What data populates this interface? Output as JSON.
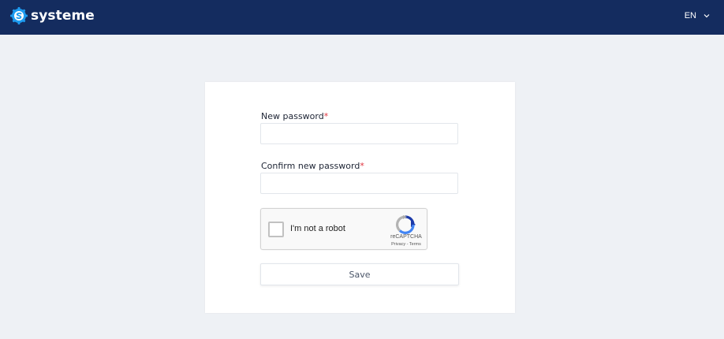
{
  "header": {
    "brand_name": "systeme",
    "language": "EN",
    "background_color": "#142c5f",
    "logo_color": "#1d9bf0"
  },
  "form": {
    "new_password_label": "New password",
    "confirm_password_label": "Confirm new password",
    "required_marker": "*",
    "new_password_value": "",
    "confirm_password_value": "",
    "save_label": "Save"
  },
  "captcha": {
    "label": "I'm not a robot",
    "brand": "reCAPTCHA",
    "privacy": "Privacy",
    "separator": " - ",
    "terms": "Terms",
    "checked": false
  }
}
